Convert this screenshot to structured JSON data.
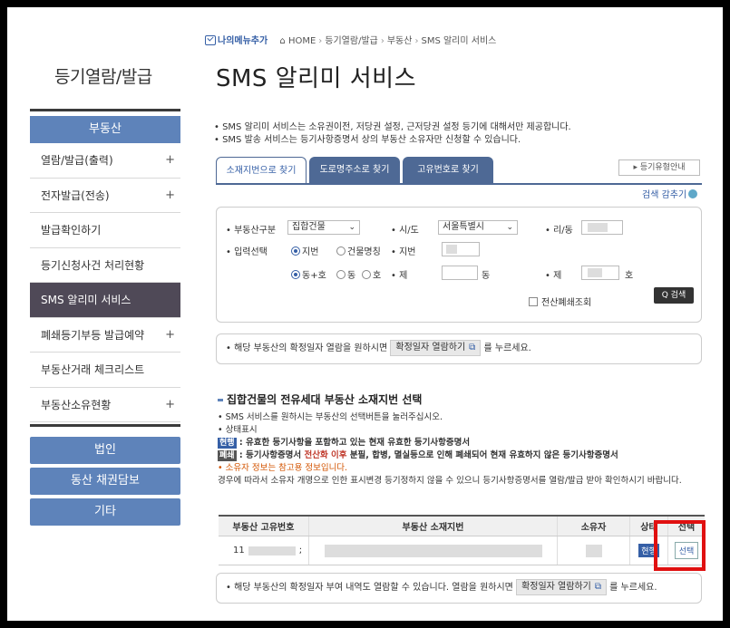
{
  "sidebar": {
    "title": "등기열람/발급",
    "head": "부동산",
    "items": [
      {
        "label": "열람/발급(출력)",
        "plus": "+"
      },
      {
        "label": "전자발급(전송)",
        "plus": "+"
      },
      {
        "label": "발급확인하기",
        "plus": ""
      },
      {
        "label": "등기신청사건 처리현황",
        "plus": ""
      },
      {
        "label": "SMS 알리미 서비스",
        "plus": ""
      },
      {
        "label": "폐쇄등기부등 발급예약",
        "plus": "+"
      },
      {
        "label": "부동산거래 체크리스트",
        "plus": ""
      },
      {
        "label": "부동산소유현황",
        "plus": "+"
      }
    ],
    "buttons": [
      "법인",
      "동산 채권담보",
      "기타"
    ]
  },
  "header": {
    "my_menu": "나의메뉴추가",
    "breadcrumb": [
      "HOME",
      "등기열람/발급",
      "부동산",
      "SMS 알리미 서비스"
    ],
    "title": "SMS 알리미 서비스"
  },
  "notes": [
    "• SMS 알리미 서비스는 소유권이전, 저당권 설정, 근저당권 설정 등기에 대해서만 제공합니다.",
    "• SMS 발송 서비스는 등기사항증명서 상의 부동산 소유자만 신청할 수 있습니다."
  ],
  "tabs": [
    "소재지번으로 찾기",
    "도로명주소로 찾기",
    "고유번호로 찾기"
  ],
  "guide_btn": "▸ 등기유형안내",
  "collapse": "검색 감추기",
  "search": {
    "type_label": "• 부동산구분",
    "type_value": "집합건물",
    "sido_label": "• 시/도",
    "sido_value": "서울특별시",
    "ri_label": "• 리/동",
    "input_label": "• 입력선택",
    "radio_jibun": "지번",
    "radio_building": "건물명칭",
    "jibun_label": "• 지번",
    "radio_dongho": "동+호",
    "radio_dong": "동",
    "radio_ho": "호",
    "je1_label": "• 제",
    "dong_suffix": "동",
    "je2_label": "• 제",
    "ho_suffix": "호",
    "closed_label": "전산폐쇄조회",
    "search_btn": "Q 검색"
  },
  "info1": {
    "prefix": "• 해당 부동산의 확정일자 열람을 원하시면",
    "btn": "확정일자 열람하기",
    "suffix": "를 누르세요."
  },
  "section": {
    "title": "집합건물의 전유세대 부동산 소재지번 선택",
    "line1": "• SMS 서비스를 원하시는 부동산의 선택버튼을 눌러주십시오.",
    "line2": "• 상태표시",
    "badge_cur": "현행",
    "cur_text": ": 유효한 등기사항을 포함하고 있는 현재 유효한 등기사항증명서",
    "badge_close": "폐쇄",
    "close_text1": ": 등기사항증명서",
    "close_red": "전산화 이후",
    "close_text2": "분필, 합병, 멸실등으로 인해 폐쇄되어 현재 유효하지 않은 등기사항증명서",
    "owner_note": "• 소유자 정보는 참고용 정보입니다.",
    "owner_detail": "경우에 따라서 소유자 개명으로 인한 표시변경 등기정하지 않을 수 있으니 등기사항증명서를 열람/발급 받아 확인하시기 바랍니다."
  },
  "table": {
    "headers": [
      "부동산 고유번호",
      "부동산 소재지번",
      "소유자",
      "상태",
      "선택"
    ],
    "row": {
      "id_prefix": "11",
      "id_suffix": ";",
      "state": "현행",
      "select": "선택"
    }
  },
  "info2": {
    "prefix": "• 해당 부동산의 확정일자 부여 내역도 열람할 수 있습니다. 열람을 원하시면",
    "btn": "확정일자 열람하기",
    "suffix": "를 누르세요."
  }
}
